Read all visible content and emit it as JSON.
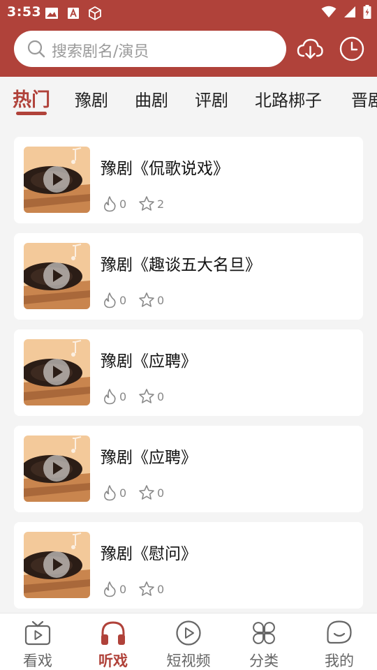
{
  "status_bar": {
    "time": "3:53"
  },
  "search": {
    "placeholder": "搜索剧名/演员"
  },
  "tabs": [
    {
      "label": "热门",
      "active": true
    },
    {
      "label": "豫剧"
    },
    {
      "label": "曲剧"
    },
    {
      "label": "评剧"
    },
    {
      "label": "北路梆子"
    },
    {
      "label": "晋剧"
    }
  ],
  "items": [
    {
      "title": "豫剧《侃歌说戏》",
      "hot": "0",
      "fav": "2"
    },
    {
      "title": "豫剧《趣谈五大名旦》",
      "hot": "0",
      "fav": "0"
    },
    {
      "title": "豫剧《应聘》",
      "hot": "0",
      "fav": "0"
    },
    {
      "title": "豫剧《应聘》",
      "hot": "0",
      "fav": "0"
    },
    {
      "title": "豫剧《慰问》",
      "hot": "0",
      "fav": "0"
    }
  ],
  "bottom_nav": [
    {
      "label": "看戏",
      "icon": "tv-icon"
    },
    {
      "label": "听戏",
      "icon": "headphones-icon",
      "active": true
    },
    {
      "label": "短视频",
      "icon": "play-circle-icon"
    },
    {
      "label": "分类",
      "icon": "category-icon"
    },
    {
      "label": "我的",
      "icon": "profile-icon"
    }
  ],
  "colors": {
    "brand": "#b0423a",
    "background": "#f4f4f4",
    "card": "#ffffff"
  }
}
